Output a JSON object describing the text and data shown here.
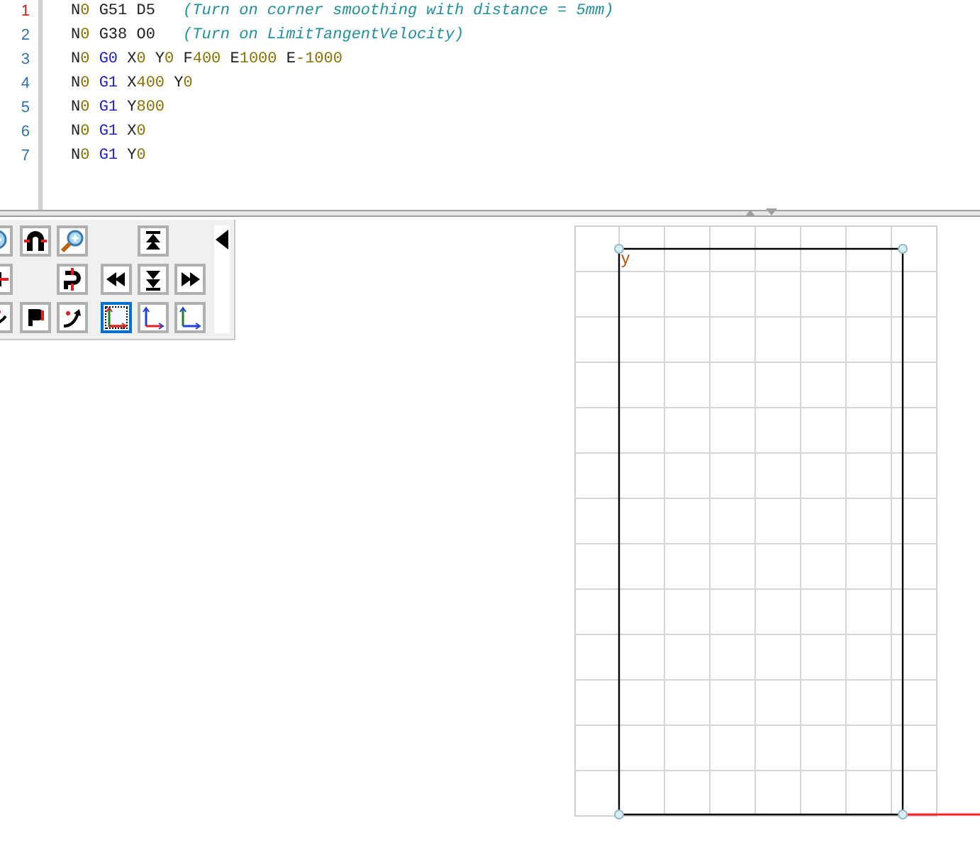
{
  "editor": {
    "lines": [
      {
        "number": "1",
        "current": true,
        "tokens": [
          {
            "text": "N0",
            "kind": "word"
          },
          {
            "text": "G51",
            "kind": "plain"
          },
          {
            "text": "D5",
            "kind": "plain"
          },
          {
            "text": "(Turn on corner smoothing with distance = 5mm)",
            "kind": "comment"
          }
        ]
      },
      {
        "number": "2",
        "current": false,
        "tokens": [
          {
            "text": "N0",
            "kind": "word"
          },
          {
            "text": "G38",
            "kind": "plain"
          },
          {
            "text": "O0",
            "kind": "plain"
          },
          {
            "text": "(Turn on LimitTangentVelocity)",
            "kind": "comment"
          }
        ]
      },
      {
        "number": "3",
        "current": false,
        "tokens": [
          {
            "text": "N0",
            "kind": "word"
          },
          {
            "text": "G0",
            "kind": "gcode"
          },
          {
            "text": "X0",
            "kind": "word"
          },
          {
            "text": "Y0",
            "kind": "word"
          },
          {
            "text": "F400",
            "kind": "word"
          },
          {
            "text": "E1000",
            "kind": "word"
          },
          {
            "text": "E-1000",
            "kind": "word"
          }
        ]
      },
      {
        "number": "4",
        "current": false,
        "tokens": [
          {
            "text": "N0",
            "kind": "word"
          },
          {
            "text": "G1",
            "kind": "gcode"
          },
          {
            "text": "X400",
            "kind": "word"
          },
          {
            "text": "Y0",
            "kind": "word"
          }
        ]
      },
      {
        "number": "5",
        "current": false,
        "tokens": [
          {
            "text": "N0",
            "kind": "word"
          },
          {
            "text": "G1",
            "kind": "gcode"
          },
          {
            "text": "Y800",
            "kind": "word"
          }
        ]
      },
      {
        "number": "6",
        "current": false,
        "tokens": [
          {
            "text": "N0",
            "kind": "word"
          },
          {
            "text": "G1",
            "kind": "gcode"
          },
          {
            "text": "X0",
            "kind": "word"
          }
        ]
      },
      {
        "number": "7",
        "current": false,
        "tokens": [
          {
            "text": "N0",
            "kind": "word"
          },
          {
            "text": "G1",
            "kind": "gcode"
          },
          {
            "text": "Y0",
            "kind": "word"
          }
        ]
      }
    ]
  },
  "toolbar": {
    "rows": [
      [
        {
          "kind": "zoom-out",
          "selected": false
        },
        {
          "kind": "rotate-horizontal",
          "selected": false
        },
        {
          "kind": "zoom-in",
          "selected": false
        },
        {
          "kind": "empty"
        },
        {
          "kind": "up",
          "selected": false
        }
      ],
      [
        {
          "kind": "pan",
          "selected": false
        },
        {
          "kind": "empty"
        },
        {
          "kind": "rotate-vertical",
          "selected": false
        },
        {
          "kind": "rewind",
          "selected": false
        },
        {
          "kind": "down",
          "selected": false
        },
        {
          "kind": "forward",
          "selected": false
        }
      ],
      [
        {
          "kind": "roll",
          "selected": false
        },
        {
          "kind": "rotate-free",
          "selected": false
        },
        {
          "kind": "curve",
          "selected": false
        },
        {
          "kind": "view-xy",
          "selected": true
        },
        {
          "kind": "view-xz",
          "selected": false
        },
        {
          "kind": "view-yz",
          "selected": false
        }
      ]
    ]
  },
  "plot": {
    "axis_label": "y"
  }
}
